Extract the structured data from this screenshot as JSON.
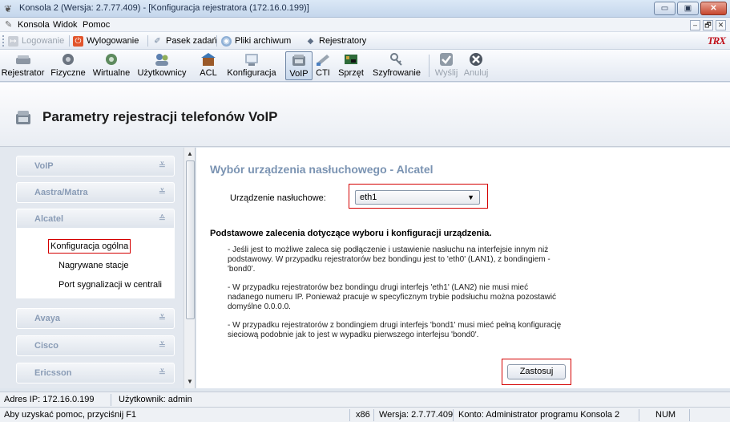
{
  "window": {
    "title": "Konsola 2 (Wersja: 2.7.77.409) - [Konfiguracja rejestratora (172.16.0.199)]",
    "minimize": "▭",
    "restore": "▣",
    "close": "✕"
  },
  "menu": {
    "items": [
      "Konsola",
      "Widok",
      "Pomoc"
    ],
    "mdi": [
      "–",
      "🗗",
      "✕"
    ]
  },
  "toolbar1": {
    "items": [
      {
        "label": "Logowanie",
        "icon": "login-icon",
        "enabled": false
      },
      {
        "label": "Wylogowanie",
        "icon": "logout-icon",
        "enabled": true
      },
      {
        "label": "Pasek zadań",
        "icon": "taskbar-icon",
        "enabled": true
      },
      {
        "label": "Pliki archiwum",
        "icon": "archive-icon",
        "enabled": true
      },
      {
        "label": "Rejestratory",
        "icon": "recorders-icon",
        "enabled": true
      }
    ],
    "logo": "TRX"
  },
  "toolbar2": {
    "items": [
      {
        "label": "Rejestrator",
        "icon": "recorder-icon",
        "active": false,
        "enabled": true
      },
      {
        "label": "Fizyczne",
        "icon": "physical-channels-icon",
        "active": false,
        "enabled": true
      },
      {
        "label": "Wirtualne",
        "icon": "virtual-channels-icon",
        "active": false,
        "enabled": true
      },
      {
        "label": "Użytkownicy",
        "icon": "users-icon",
        "active": false,
        "enabled": true
      },
      {
        "label": "ACL",
        "icon": "acl-icon",
        "active": false,
        "enabled": true
      },
      {
        "label": "Konfiguracja",
        "icon": "configuration-icon",
        "active": false,
        "enabled": true
      },
      {
        "label": "VoIP",
        "icon": "voip-phone-icon",
        "active": true,
        "enabled": true
      },
      {
        "label": "CTI",
        "icon": "cti-icon",
        "active": false,
        "enabled": true
      },
      {
        "label": "Sprzęt",
        "icon": "hardware-icon",
        "active": false,
        "enabled": true
      },
      {
        "label": "Szyfrowanie",
        "icon": "encryption-key-icon",
        "active": false,
        "enabled": true
      },
      {
        "label": "Wyślij",
        "icon": "send-check-icon",
        "active": false,
        "enabled": false
      },
      {
        "label": "Anuluj",
        "icon": "cancel-x-icon",
        "active": false,
        "enabled": false
      }
    ]
  },
  "header": {
    "title": "Parametry rejestracji telefonów VoIP"
  },
  "nav": {
    "groups": [
      {
        "label": "VoIP",
        "expanded": false
      },
      {
        "label": "Aastra/Matra",
        "expanded": false
      },
      {
        "label": "Alcatel",
        "expanded": true
      },
      {
        "label": "Avaya",
        "expanded": false
      },
      {
        "label": "Cisco",
        "expanded": false
      },
      {
        "label": "Ericsson",
        "expanded": false
      }
    ],
    "alcatel_links": [
      "Konfiguracja ogólna",
      "Nagrywane stacje",
      "Port sygnalizacji w centrali"
    ]
  },
  "main": {
    "section_title": "Wybór urządzenia nasłuchowego - Alcatel",
    "device_label": "Urządzenie nasłuchowe:",
    "device_value": "eth1",
    "rec_title": "Podstawowe zalecenia dotyczące wyboru i konfiguracji urządzenia.",
    "rec_1": "- Jeśli jest to możliwe zaleca się podłączenie i ustawienie nasłuchu na interfejsie innym niż podstawowy. W przypadku rejestratorów bez bondingu jest to 'eth0' (LAN1), z bondingiem - 'bond0'.",
    "rec_2": "- W przypadku rejestratorów bez bondingu drugi interfejs 'eth1' (LAN2) nie musi mieć nadanego numeru IP. Ponieważ pracuje w specyficznym trybie podsłuchu można pozostawić domyślne 0.0.0.0.",
    "rec_3": "- W przypadku rejestratorów z bondingiem drugi interfejs 'bond1' musi mieć pełną konfigurację sieciową podobnie jak to jest w wypadku pierwszego interfejsu 'bond0'.",
    "apply_label": "Zastosuj"
  },
  "status": {
    "ip": "Adres IP: 172.16.0.199",
    "user": "Użytkownik: admin",
    "help": "Aby uzyskać pomoc, przyciśnij F1",
    "arch": "x86",
    "version": "Wersja: 2.7.77.409",
    "account": "Konto: Administrator programu Konsola 2",
    "num": "NUM"
  },
  "colors": {
    "highlight": "#d40000",
    "section_title": "#7a93b2",
    "nav_label": "#8a9cb6"
  }
}
